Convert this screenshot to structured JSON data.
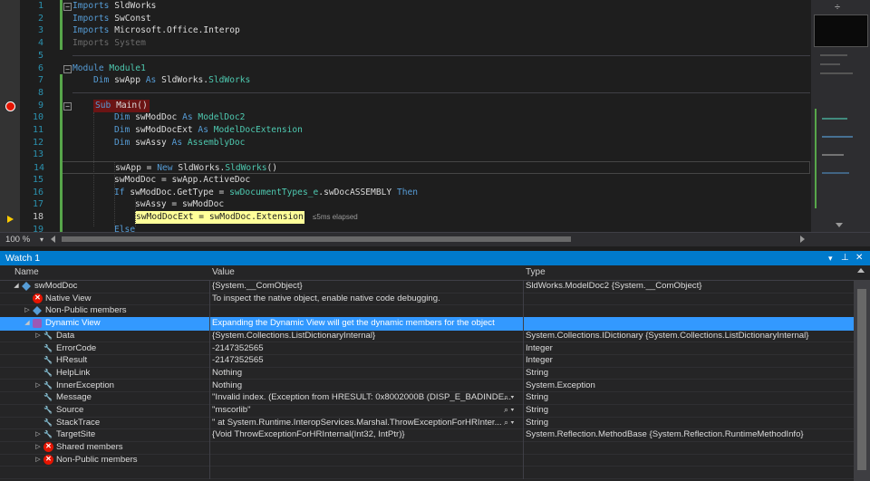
{
  "editor": {
    "lines": [
      {
        "n": "1",
        "segs": [
          [
            "kw",
            "Imports"
          ],
          [
            "",
            " SldWorks"
          ]
        ]
      },
      {
        "n": "2",
        "segs": [
          [
            "kw",
            "Imports"
          ],
          [
            "",
            " SwConst"
          ]
        ]
      },
      {
        "n": "3",
        "segs": [
          [
            "kw",
            "Imports"
          ],
          [
            "",
            " Microsoft.Office.Interop"
          ]
        ]
      },
      {
        "n": "4",
        "segs": [
          [
            "grey",
            "Imports System"
          ]
        ]
      },
      {
        "n": "5",
        "segs": []
      },
      {
        "n": "6",
        "segs": [
          [
            "kw",
            "Module"
          ],
          [
            "ty",
            " Module1"
          ]
        ]
      },
      {
        "n": "7",
        "segs": [
          [
            "kw",
            "Dim"
          ],
          [
            "",
            " swApp "
          ],
          [
            "kw",
            "As"
          ],
          [
            "",
            " SldWorks."
          ],
          [
            "ty",
            "SldWorks"
          ]
        ]
      },
      {
        "n": "8",
        "segs": []
      },
      {
        "n": "9",
        "segs": [
          [
            "kw",
            "Sub"
          ],
          [
            "",
            " Main()"
          ]
        ]
      },
      {
        "n": "10",
        "segs": [
          [
            "kw",
            "Dim"
          ],
          [
            "",
            " swModDoc "
          ],
          [
            "kw",
            "As"
          ],
          [
            "ty",
            " ModelDoc2"
          ]
        ]
      },
      {
        "n": "11",
        "segs": [
          [
            "kw",
            "Dim"
          ],
          [
            "",
            " swModDocExt "
          ],
          [
            "kw",
            "As"
          ],
          [
            "ty",
            " ModelDocExtension"
          ]
        ]
      },
      {
        "n": "12",
        "segs": [
          [
            "kw",
            "Dim"
          ],
          [
            "",
            " swAssy "
          ],
          [
            "kw",
            "As"
          ],
          [
            "ty",
            " AssemblyDoc"
          ]
        ]
      },
      {
        "n": "13",
        "segs": []
      },
      {
        "n": "14",
        "segs": [
          [
            "",
            "swApp = "
          ],
          [
            "kw",
            "New"
          ],
          [
            "",
            " SldWorks."
          ],
          [
            "ty",
            "SldWorks"
          ],
          [
            "",
            "()"
          ]
        ]
      },
      {
        "n": "15",
        "segs": [
          [
            "",
            "swModDoc = swApp.ActiveDoc"
          ]
        ]
      },
      {
        "n": "16",
        "segs": [
          [
            "kw",
            "If"
          ],
          [
            "",
            " swModDoc.GetType = "
          ],
          [
            "ty",
            "swDocumentTypes_e"
          ],
          [
            "",
            ".swDocASSEMBLY "
          ],
          [
            "kw",
            "Then"
          ]
        ]
      },
      {
        "n": "17",
        "segs": [
          [
            "",
            "swAssy = swModDoc"
          ]
        ]
      },
      {
        "n": "18",
        "segs": [
          [
            "",
            "swModDocExt = swModDoc.Extension"
          ]
        ]
      },
      {
        "n": "19",
        "segs": [
          [
            "kw",
            "Else"
          ]
        ]
      }
    ],
    "elapsed": "≤5ms elapsed",
    "zoom": "100 %"
  },
  "watch": {
    "title": "Watch 1",
    "headers": {
      "name": "Name",
      "value": "Value",
      "type": "Type"
    },
    "rows": [
      {
        "name": "swModDoc",
        "value": "{System.__ComObject}",
        "type": "SldWorks.ModelDoc2 {System.__ComObject}",
        "icon": "cube-icon",
        "depth": 0,
        "exp": "▲"
      },
      {
        "name": "Native View",
        "value": "To inspect the native object, enable native code debugging.",
        "type": "",
        "icon": "error-icon",
        "depth": 1,
        "exp": ""
      },
      {
        "name": "Non-Public members",
        "value": "",
        "type": "",
        "icon": "cube-icon",
        "depth": 1,
        "exp": "▶"
      },
      {
        "name": "Dynamic View",
        "value": "Expanding the Dynamic View will get the dynamic members for the object",
        "type": "",
        "icon": "dynamic-icon",
        "depth": 1,
        "exp": "▲",
        "sel": true
      },
      {
        "name": "Data",
        "value": "{System.Collections.ListDictionaryInternal}",
        "type": "System.Collections.IDictionary {System.Collections.ListDictionaryInternal}",
        "icon": "wrench-icon",
        "depth": 2,
        "exp": "▶"
      },
      {
        "name": "ErrorCode",
        "value": "-2147352565",
        "type": "Integer",
        "icon": "wrench-icon",
        "depth": 2,
        "exp": ""
      },
      {
        "name": "HResult",
        "value": "-2147352565",
        "type": "Integer",
        "icon": "wrench-icon",
        "depth": 2,
        "exp": ""
      },
      {
        "name": "HelpLink",
        "value": "Nothing",
        "type": "String",
        "icon": "wrench-icon",
        "depth": 2,
        "exp": ""
      },
      {
        "name": "InnerException",
        "value": "Nothing",
        "type": "System.Exception",
        "icon": "wrench-icon",
        "depth": 2,
        "exp": "▶"
      },
      {
        "name": "Message",
        "value": "\"Invalid index. (Exception from HRESULT: 0x8002000B (DISP_E_BADINDE...",
        "type": "String",
        "icon": "wrench-icon",
        "depth": 2,
        "exp": "",
        "mag": true
      },
      {
        "name": "Source",
        "value": "\"mscorlib\"",
        "type": "String",
        "icon": "wrench-icon",
        "depth": 2,
        "exp": "",
        "mag": true
      },
      {
        "name": "StackTrace",
        "value": "\"   at System.Runtime.InteropServices.Marshal.ThrowExceptionForHRInter...",
        "type": "String",
        "icon": "wrench-icon",
        "depth": 2,
        "exp": "",
        "mag": true
      },
      {
        "name": "TargetSite",
        "value": "{Void ThrowExceptionForHRInternal(Int32, IntPtr)}",
        "type": "System.Reflection.MethodBase {System.Reflection.RuntimeMethodInfo}",
        "icon": "wrench-icon",
        "depth": 2,
        "exp": "▶"
      },
      {
        "name": "Shared members",
        "value": "",
        "type": "",
        "icon": "error-icon",
        "depth": 2,
        "exp": "▶"
      },
      {
        "name": "Non-Public members",
        "value": "",
        "type": "",
        "icon": "error-icon",
        "depth": 2,
        "exp": "▶"
      }
    ]
  },
  "colors": {
    "accent": "#007acc",
    "selection": "#3399ff",
    "breakpoint": "#e51400"
  }
}
